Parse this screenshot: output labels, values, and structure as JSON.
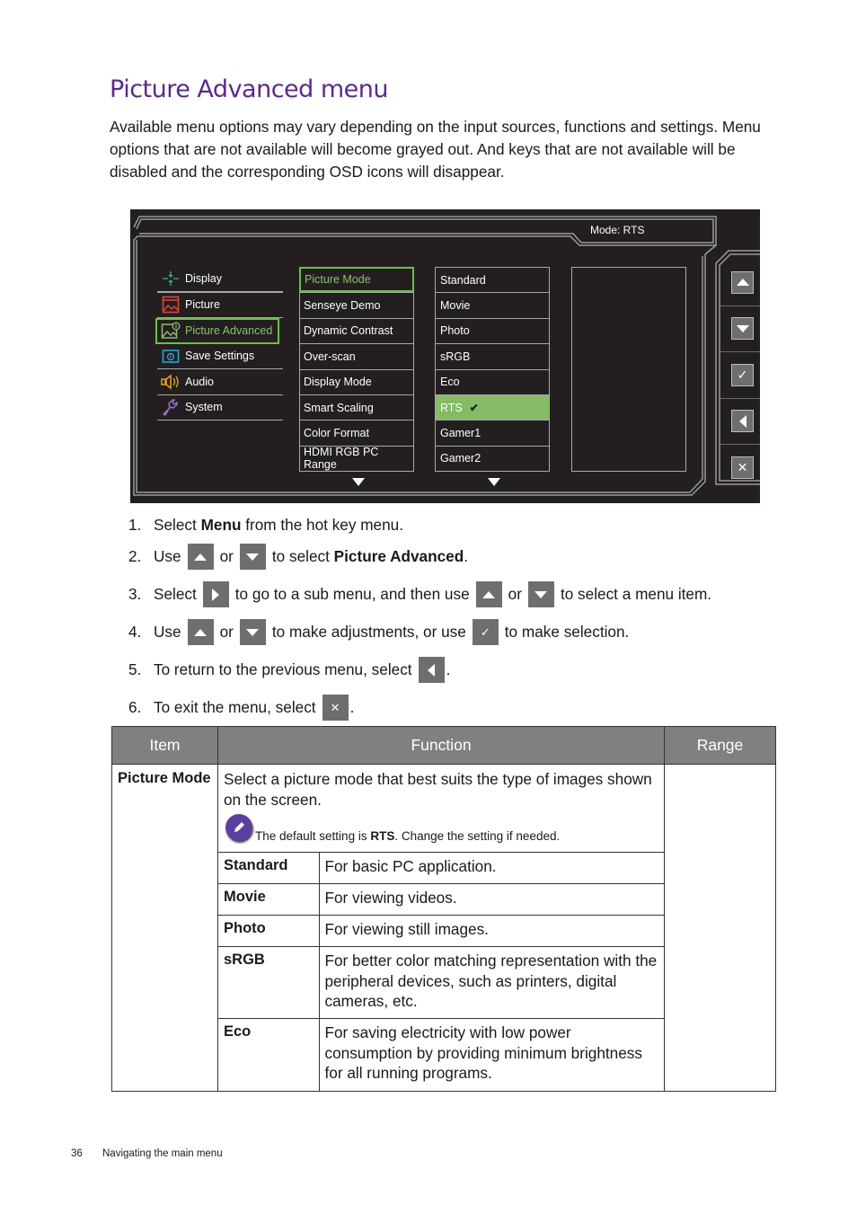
{
  "page": {
    "title": "Picture Advanced menu",
    "intro": "Available menu options may vary depending on the input sources, functions and settings. Menu options that are not available will become grayed out. And keys that are not available will be disabled and the corresponding OSD icons will disappear."
  },
  "osd": {
    "mode_label": "Mode: RTS",
    "accent_color": "#6ebd4b",
    "main_menu": [
      {
        "label": "Display",
        "icon": "display-icon",
        "active": false
      },
      {
        "label": "Picture",
        "icon": "picture-icon",
        "active": false
      },
      {
        "label": "Picture Advanced",
        "icon": "picture-advanced-icon",
        "active": true
      },
      {
        "label": "Save Settings",
        "icon": "save-settings-icon",
        "active": false
      },
      {
        "label": "Audio",
        "icon": "audio-icon",
        "active": false
      },
      {
        "label": "System",
        "icon": "system-icon",
        "active": false
      }
    ],
    "sub_menu": [
      {
        "label": "Picture Mode",
        "active": true
      },
      {
        "label": "Senseye Demo",
        "active": false
      },
      {
        "label": "Dynamic Contrast",
        "active": false
      },
      {
        "label": "Over-scan",
        "active": false
      },
      {
        "label": "Display Mode",
        "active": false
      },
      {
        "label": "Smart Scaling",
        "active": false
      },
      {
        "label": "Color Format",
        "active": false
      },
      {
        "label": "HDMI RGB PC Range",
        "active": false
      }
    ],
    "options": [
      {
        "label": "Standard",
        "selected": false
      },
      {
        "label": "Movie",
        "selected": false
      },
      {
        "label": "Photo",
        "selected": false
      },
      {
        "label": "sRGB",
        "selected": false
      },
      {
        "label": "Eco",
        "selected": false
      },
      {
        "label": "RTS",
        "selected": true
      },
      {
        "label": "Gamer1",
        "selected": false
      },
      {
        "label": "Gamer2",
        "selected": false
      }
    ],
    "keys": [
      "up-arrow-icon",
      "down-arrow-icon",
      "check-icon",
      "left-arrow-icon",
      "close-icon"
    ]
  },
  "steps": [
    {
      "num": "1.",
      "parts": [
        "Select ",
        "Menu",
        " from the hot key menu."
      ]
    },
    {
      "num": "2.",
      "parts": [
        "Use",
        "or",
        "to select ",
        "Picture Advanced",
        "."
      ]
    },
    {
      "num": "3.",
      "parts": [
        "Select",
        "to go to a sub menu, and then use",
        "or",
        "to select a menu item."
      ]
    },
    {
      "num": "4.",
      "parts": [
        "Use",
        "or",
        "to make adjustments, or use",
        "to make selection."
      ]
    },
    {
      "num": "5.",
      "parts": [
        "To return to the previous menu, select",
        "."
      ]
    },
    {
      "num": "6.",
      "parts": [
        "To exit the menu, select",
        "."
      ]
    }
  ],
  "table": {
    "headers": [
      "Item",
      "Function",
      "Range"
    ],
    "item": "Picture Mode",
    "description": "Select a picture mode that best suits the type of images shown on the screen.",
    "note": {
      "prefix": "The default setting is ",
      "bold": "RTS",
      "suffix": ". Change the setting if needed."
    },
    "modes": [
      {
        "name": "Standard",
        "desc": "For basic PC application."
      },
      {
        "name": "Movie",
        "desc": "For viewing videos."
      },
      {
        "name": "Photo",
        "desc": "For viewing still images."
      },
      {
        "name": "sRGB",
        "desc": "For better color matching representation with the peripheral devices, such as printers, digital cameras, etc."
      },
      {
        "name": "Eco",
        "desc": "For saving electricity with low power consumption by providing minimum brightness for all running programs."
      }
    ],
    "range": ""
  },
  "footer": {
    "page_number": "36",
    "section": "Navigating the main menu"
  }
}
